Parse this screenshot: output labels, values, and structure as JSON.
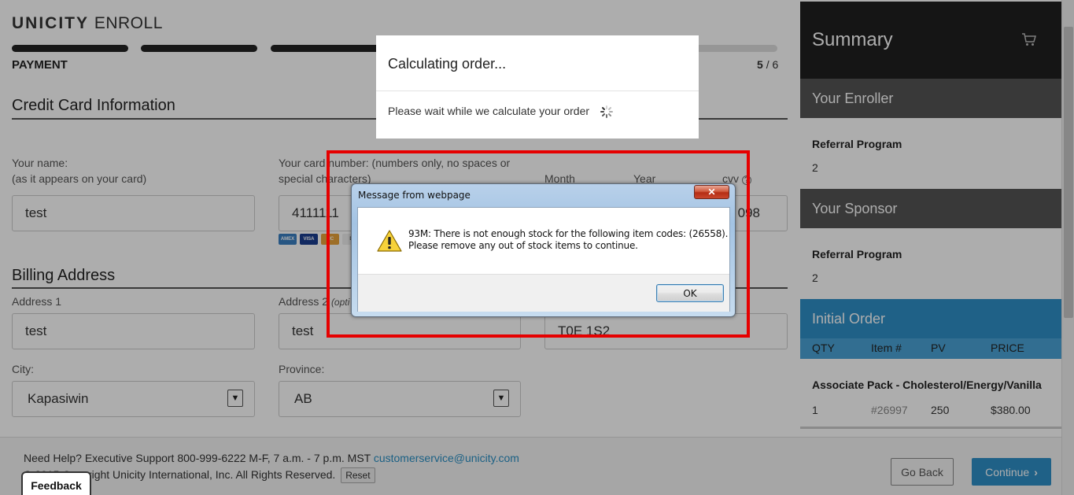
{
  "brand": {
    "bold": "UNICITY",
    "light": "ENROLL"
  },
  "progress": {
    "step_label": "PAYMENT",
    "current": "5",
    "total": "/ 6",
    "fraction": 0.83
  },
  "credit_card": {
    "title": "Credit Card Information",
    "name_label_1": "Your name:",
    "name_label_2": "(as it appears on your card)",
    "name_value": "test",
    "number_label_1": "Your card number: (numbers only, no spaces or",
    "number_label_2": "special characters)",
    "number_value": "4111111",
    "month_label": "Month",
    "year_label": "Year",
    "cvv_label": "cvv",
    "cvv_value": "098",
    "card_icons": [
      "amex-icon",
      "visa-icon",
      "mastercard-icon",
      "discover-icon"
    ]
  },
  "billing": {
    "title": "Billing Address",
    "address1_label": "Address 1",
    "address1_value": "test",
    "address2_label": "Address 2",
    "address2_optional": "(opti",
    "address2_value": "test",
    "postal_value": "T0E 1S2",
    "city_label": "City:",
    "city_value": "Kapasiwin",
    "province_label": "Province:",
    "province_value": "AB"
  },
  "sidebar": {
    "title": "Summary",
    "enroller_title": "Your Enroller",
    "enroller_name": "Referral Program",
    "enroller_id": "2",
    "sponsor_title": "Your Sponsor",
    "sponsor_name": "Referral Program",
    "sponsor_id": "2",
    "order_title": "Initial Order",
    "columns": [
      "QTY",
      "Item #",
      "PV",
      "PRICE"
    ],
    "item": {
      "name": "Associate Pack - Cholesterol/Energy/Vanilla",
      "qty": "1",
      "item_no": "#26997",
      "pv": "250",
      "price": "$380.00"
    },
    "colors": {
      "dark": "#1f1f1f",
      "gray": "#555555",
      "blue": "#2f8fc8",
      "blue_light": "#4aa3d6"
    }
  },
  "footer": {
    "help_text": "Need Help? Executive Support 800-999-6222 M-F, 7 a.m. - 7 p.m. MST",
    "help_email": "customerservice@unicity.com",
    "copyright": "© 2015 Copyright Unicity International, Inc. All Rights Reserved.",
    "reset_label": "Reset",
    "back_label": "Go Back",
    "continue_label": "Continue",
    "feedback_label": "Feedback"
  },
  "calc_modal": {
    "title": "Calculating order...",
    "message": "Please wait while we calculate your order"
  },
  "dialog": {
    "caption": "Message from webpage",
    "line1": "93M: There is not enough stock for the following item codes: (26558).",
    "line2": "Please remove any out of stock items to continue.",
    "ok_label": "OK",
    "close_glyph": "✕"
  }
}
